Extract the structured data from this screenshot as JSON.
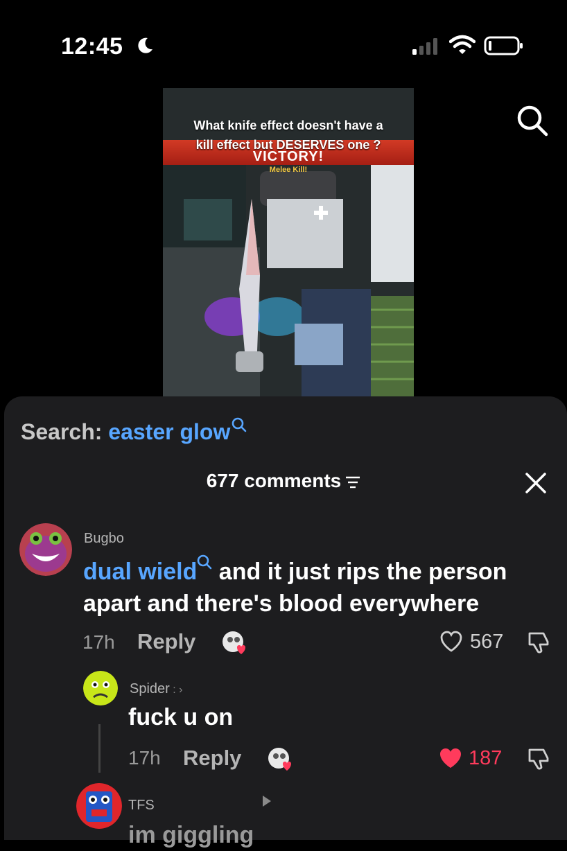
{
  "status_bar": {
    "time": "12:45"
  },
  "video": {
    "question_line1": "What knife effect doesn't have a",
    "question_line2": "kill effect but DESERVES one ?",
    "banner_title": "VICTORY!",
    "banner_subtitle": "Melee Kill!"
  },
  "search": {
    "prefix": "Search: ",
    "term": "easter glow"
  },
  "comments_header": {
    "count_label": "677 comments"
  },
  "comments": [
    {
      "username": "Bugbo",
      "text_link": "dual wield",
      "text": " and it just rips the person apart and there's blood everywhere",
      "time": "17h",
      "reply_label": "Reply",
      "likes": "567"
    },
    {
      "username": "Spider",
      "username_suffix": " : ›",
      "text": "fuck u on",
      "time": "17h",
      "reply_label": "Reply",
      "likes": "187"
    },
    {
      "username": "TFS",
      "text": "im giggling"
    }
  ],
  "colors": {
    "accent_link": "#58a6ff",
    "liked_heart": "#ff3b5c",
    "sheet_bg": "#1d1d1f"
  }
}
